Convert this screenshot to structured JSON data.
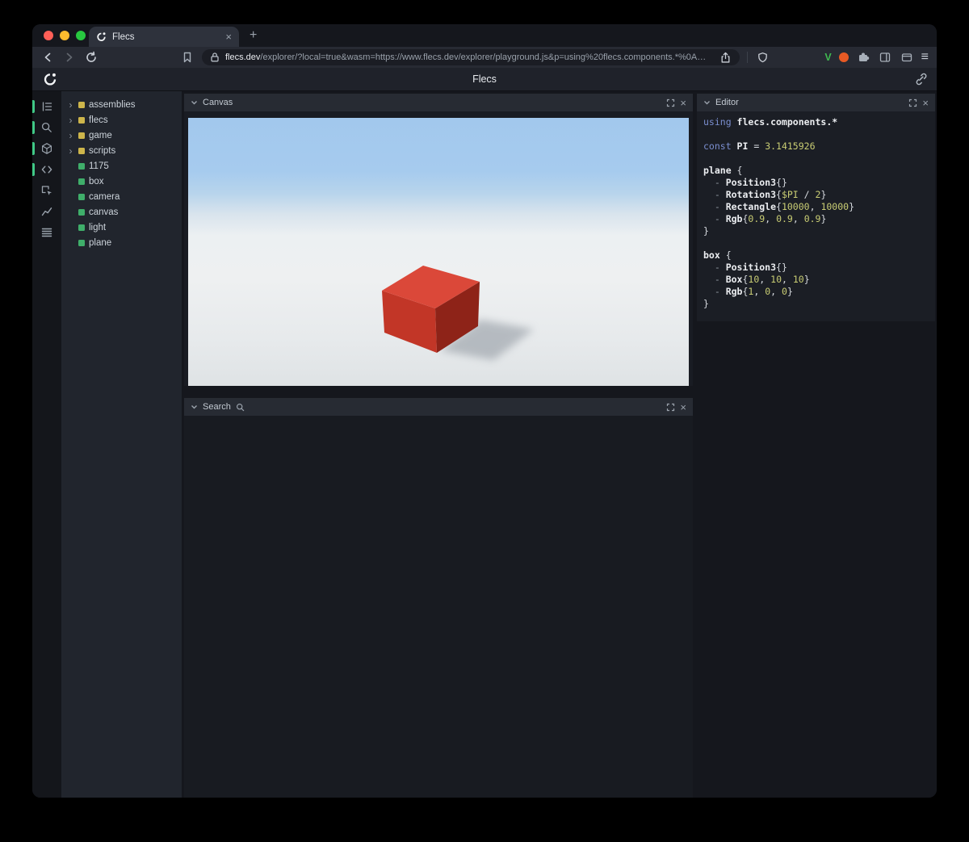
{
  "glyphs": {
    "close": "×",
    "plus": "+",
    "menu": "≡",
    "expander": "›"
  },
  "browser": {
    "tab": {
      "title": "Flecs"
    },
    "toolbar": {
      "url_host": "flecs.dev",
      "url_rest": "/explorer/?local=true&wasm=https://www.flecs.dev/explorer/playground.js&p=using%20flecs.components.*%0A…",
      "extension_v_label": "V"
    }
  },
  "app_header": {
    "title": "Flecs"
  },
  "panels": {
    "canvas": {
      "title": "Canvas"
    },
    "search": {
      "title": "Search"
    },
    "editor": {
      "title": "Editor"
    }
  },
  "rail": {
    "items": [
      {
        "name": "entities",
        "active": true
      },
      {
        "name": "query",
        "active": true
      },
      {
        "name": "canvas",
        "active": true
      },
      {
        "name": "editor",
        "active": true
      },
      {
        "name": "inspector",
        "active": false
      },
      {
        "name": "charts",
        "active": false
      },
      {
        "name": "stats",
        "active": false
      }
    ]
  },
  "tree": {
    "items": [
      {
        "label": "assemblies",
        "type": "module",
        "color": "#cdb54b",
        "expandable": true
      },
      {
        "label": "flecs",
        "type": "module",
        "color": "#cdb54b",
        "expandable": true
      },
      {
        "label": "game",
        "type": "module",
        "color": "#cdb54b",
        "expandable": true
      },
      {
        "label": "scripts",
        "type": "module",
        "color": "#cdb54b",
        "expandable": true
      },
      {
        "label": "1175",
        "type": "entity",
        "color": "#3fae6a",
        "expandable": false
      },
      {
        "label": "box",
        "type": "entity",
        "color": "#3fae6a",
        "expandable": false
      },
      {
        "label": "camera",
        "type": "entity",
        "color": "#3fae6a",
        "expandable": false
      },
      {
        "label": "canvas",
        "type": "entity",
        "color": "#3fae6a",
        "expandable": false
      },
      {
        "label": "light",
        "type": "entity",
        "color": "#3fae6a",
        "expandable": false
      },
      {
        "label": "plane",
        "type": "entity",
        "color": "#3fae6a",
        "expandable": false
      }
    ]
  },
  "scene": {
    "object": "red box on plane",
    "colors": {
      "sky": "#a2c8ed",
      "ground": "#edf0f1",
      "box_top": "#db4839",
      "box_front": "#c23627",
      "box_side": "#8e2318",
      "shadow": "#8d949d",
      "accent_green": "#40c987"
    }
  },
  "editor": {
    "lines": [
      [
        {
          "t": "using ",
          "c": "kw"
        },
        {
          "t": "flecs.components.*",
          "c": "comp"
        }
      ],
      [],
      [
        {
          "t": "const ",
          "c": "kw"
        },
        {
          "t": "PI",
          "c": "comp"
        },
        {
          "t": " = ",
          "c": "plain"
        },
        {
          "t": "3.1415926",
          "c": "num"
        }
      ],
      [],
      [
        {
          "t": "plane",
          "c": "comp"
        },
        {
          "t": " {",
          "c": "plain"
        }
      ],
      [
        {
          "t": "  - ",
          "c": "punct"
        },
        {
          "t": "Position3",
          "c": "comp"
        },
        {
          "t": "{}",
          "c": "plain"
        }
      ],
      [
        {
          "t": "  - ",
          "c": "punct"
        },
        {
          "t": "Rotation3",
          "c": "comp"
        },
        {
          "t": "{",
          "c": "plain"
        },
        {
          "t": "$PI",
          "c": "num"
        },
        {
          "t": " / ",
          "c": "plain"
        },
        {
          "t": "2",
          "c": "num"
        },
        {
          "t": "}",
          "c": "plain"
        }
      ],
      [
        {
          "t": "  - ",
          "c": "punct"
        },
        {
          "t": "Rectangle",
          "c": "comp"
        },
        {
          "t": "{",
          "c": "plain"
        },
        {
          "t": "10000",
          "c": "num"
        },
        {
          "t": ", ",
          "c": "plain"
        },
        {
          "t": "10000",
          "c": "num"
        },
        {
          "t": "}",
          "c": "plain"
        }
      ],
      [
        {
          "t": "  - ",
          "c": "punct"
        },
        {
          "t": "Rgb",
          "c": "comp"
        },
        {
          "t": "{",
          "c": "plain"
        },
        {
          "t": "0.9",
          "c": "num"
        },
        {
          "t": ", ",
          "c": "plain"
        },
        {
          "t": "0.9",
          "c": "num"
        },
        {
          "t": ", ",
          "c": "plain"
        },
        {
          "t": "0.9",
          "c": "num"
        },
        {
          "t": "}",
          "c": "plain"
        }
      ],
      [
        {
          "t": "}",
          "c": "plain"
        }
      ],
      [],
      [
        {
          "t": "box",
          "c": "comp"
        },
        {
          "t": " {",
          "c": "plain"
        }
      ],
      [
        {
          "t": "  - ",
          "c": "punct"
        },
        {
          "t": "Position3",
          "c": "comp"
        },
        {
          "t": "{}",
          "c": "plain"
        }
      ],
      [
        {
          "t": "  - ",
          "c": "punct"
        },
        {
          "t": "Box",
          "c": "comp"
        },
        {
          "t": "{",
          "c": "plain"
        },
        {
          "t": "10",
          "c": "num"
        },
        {
          "t": ", ",
          "c": "plain"
        },
        {
          "t": "10",
          "c": "num"
        },
        {
          "t": ", ",
          "c": "plain"
        },
        {
          "t": "10",
          "c": "num"
        },
        {
          "t": "}",
          "c": "plain"
        }
      ],
      [
        {
          "t": "  - ",
          "c": "punct"
        },
        {
          "t": "Rgb",
          "c": "comp"
        },
        {
          "t": "{",
          "c": "plain"
        },
        {
          "t": "1",
          "c": "num"
        },
        {
          "t": ", ",
          "c": "plain"
        },
        {
          "t": "0",
          "c": "num"
        },
        {
          "t": ", ",
          "c": "plain"
        },
        {
          "t": "0",
          "c": "num"
        },
        {
          "t": "}",
          "c": "plain"
        }
      ],
      [
        {
          "t": "}",
          "c": "plain"
        }
      ]
    ]
  }
}
